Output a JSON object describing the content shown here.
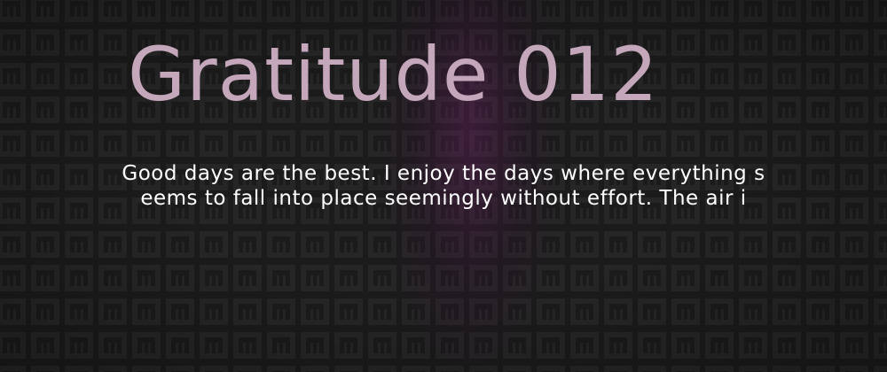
{
  "banner": {
    "title": "Gratitude 012",
    "excerpt_lines": [
      "Good days are the best.  I enjoy the days where everything s",
      "eems to fall into place seemingly without effort.  The air i"
    ]
  },
  "colors": {
    "background": "#1b1b1b",
    "tile": "#262626",
    "title": "#c4a7bb",
    "excerpt": "#ffffff",
    "accent_glow": "#782e6e"
  }
}
